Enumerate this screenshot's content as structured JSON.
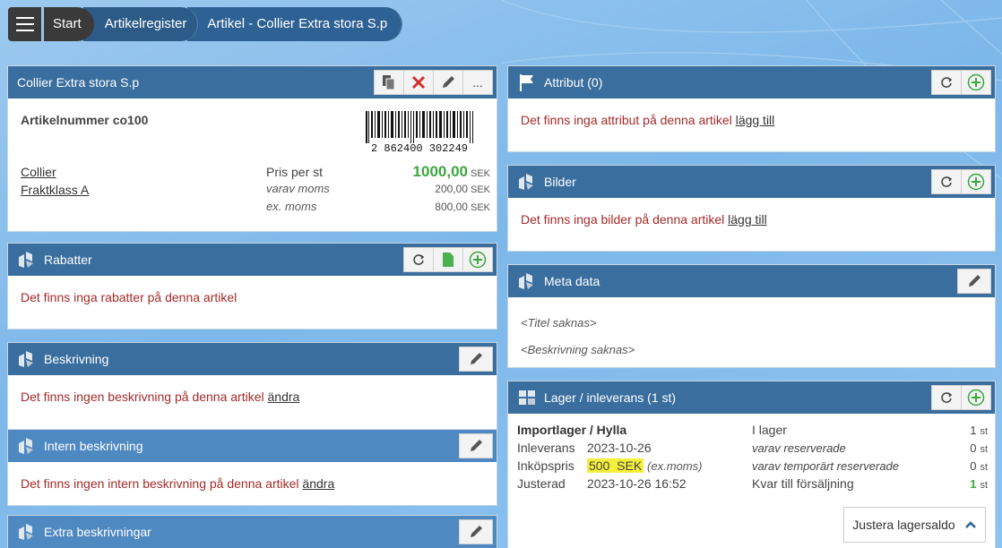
{
  "breadcrumb": {
    "start": "Start",
    "register": "Artikelregister",
    "article": "Artikel - Collier Extra stora S.p"
  },
  "article_panel": {
    "title": "Collier Extra stora S.p",
    "more_label": "...",
    "article_number": "Artikelnummer co100",
    "barcode_digits": "2 862400 302249",
    "links": [
      "Collier",
      "Fraktklass A"
    ],
    "price_label": "Pris per st",
    "price_value": "1000,00",
    "vat_label": "varav moms",
    "vat_value": "200,00",
    "ex_vat_label": "ex. moms",
    "ex_vat_value": "800,00",
    "currency": "SEK"
  },
  "rabatter": {
    "title": "Rabatter",
    "message": "Det finns inga rabatter på denna artikel"
  },
  "beskrivning": {
    "title": "Beskrivning",
    "message": "Det finns ingen beskrivning på denna artikel",
    "link": "ändra"
  },
  "intern": {
    "title": "Intern beskrivning",
    "message": "Det finns ingen intern beskrivning på denna artikel",
    "link": "ändra"
  },
  "extra": {
    "title": "Extra beskrivningar"
  },
  "attribut": {
    "title": "Attribut (0)",
    "message": "Det finns inga attribut på denna artikel",
    "link": "lägg till"
  },
  "bilder": {
    "title": "Bilder",
    "message": "Det finns inga bilder på denna artikel",
    "link": "lägg till"
  },
  "meta": {
    "title": "Meta data",
    "title_missing": "<Titel saknas>",
    "desc_missing": "<Beskrivning saknas>"
  },
  "lager": {
    "title": "Lager / inleverans (1 st)",
    "location": "Importlager / Hylla",
    "inleverans_label": "Inleverans",
    "inleverans_value": "2023-10-26",
    "inkopspris_label": "Inköpspris",
    "inkopspris_value": "500  SEK",
    "inkopspris_note": "(ex.moms)",
    "justerad_label": "Justerad",
    "justerad_value": "2023-10-26 16:52",
    "stock_label": "I lager",
    "stock_value": "1",
    "reserved_label": "varav reserverade",
    "reserved_value": "0",
    "temp_reserved_label": "varav temporärt reserverade",
    "temp_reserved_value": "0",
    "for_sale_label": "Kvar till försäljning",
    "for_sale_value": "1",
    "unit": "st",
    "adjust_button": "Justera lagersaldo"
  }
}
